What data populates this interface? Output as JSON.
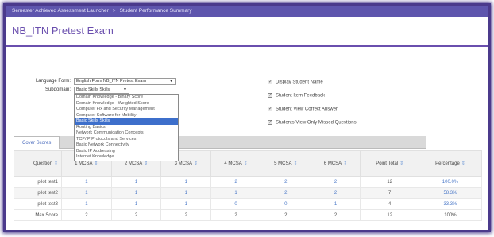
{
  "breadcrumb": {
    "item1": "Semester Achieved Assessment Launcher",
    "sep": ">",
    "item2": "Student Performance Summary"
  },
  "page_title": "NB_ITN Pretest Exam",
  "filters": {
    "language_label": "Language Form:",
    "language_value": "English Form NB_ITN Pretest Exam",
    "subdomain_label": "Subdomain:",
    "subdomain_value": "Basic Skills Skills",
    "subdomain_options": [
      "Domain Knowledge - Binary Score",
      "Domain Knowledge - Weighted Score",
      "Computer Fix and Security Management",
      "Computer Software for Mobility",
      "Basic Skills Skills",
      "Routing Basics",
      "Network Communication Concepts",
      "TCP/IP Protocols and Services",
      "Basic Network Connectivity",
      "Basic IP Addressing",
      "Internet Knowledge"
    ],
    "selected_index": 4
  },
  "options": [
    "Display Student Name",
    "Student Item Feedback",
    "Student View Correct Answer",
    "Students View Only Missed Questions"
  ],
  "tabs": {
    "active": "Cover Scores"
  },
  "table": {
    "headers": [
      "Question",
      "1 MCSA",
      "2 MCSA",
      "3 MCSA",
      "4 MCSA",
      "5 MCSA",
      "6 MCSA",
      "Point Total",
      "Percentage"
    ],
    "rows": [
      {
        "name": "pilot test1",
        "cells": [
          "1",
          "1",
          "1",
          "2",
          "2",
          "2",
          "12",
          "100.0%"
        ]
      },
      {
        "name": "pilot test2",
        "cells": [
          "1",
          "1",
          "1",
          "1",
          "2",
          "2",
          "7",
          "58.3%"
        ]
      },
      {
        "name": "pilot test3",
        "cells": [
          "1",
          "1",
          "1",
          "0",
          "0",
          "1",
          "4",
          "33.3%"
        ]
      },
      {
        "name": "Max Score",
        "cells": [
          "2",
          "2",
          "2",
          "2",
          "2",
          "2",
          "12",
          "100%"
        ]
      }
    ]
  },
  "colors": {
    "accent": "#6a4fae",
    "topbar": "#5e55ad",
    "selected": "#3d6fcb"
  }
}
